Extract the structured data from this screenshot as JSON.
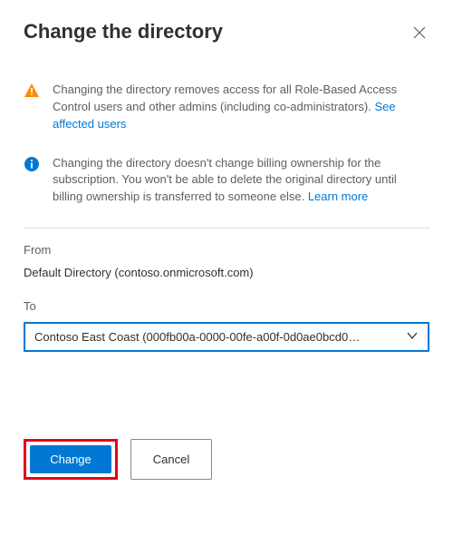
{
  "header": {
    "title": "Change the directory"
  },
  "warnings": [
    {
      "text_before": "Changing the directory removes access for all Role-Based Access Control users and other admins (including co-administrators). ",
      "link": "See affected users"
    },
    {
      "text_before": "Changing the directory doesn't change billing ownership for the subscription. You won't be able to delete the original directory until billing ownership is transferred to someone else. ",
      "link": "Learn more"
    }
  ],
  "form": {
    "from_label": "From",
    "from_value": "Default Directory (contoso.onmicrosoft.com)",
    "to_label": "To",
    "to_value": "Contoso East Coast (000fb00a-0000-00fe-a00f-0d0ae0bcd0…"
  },
  "buttons": {
    "change": "Change",
    "cancel": "Cancel"
  }
}
